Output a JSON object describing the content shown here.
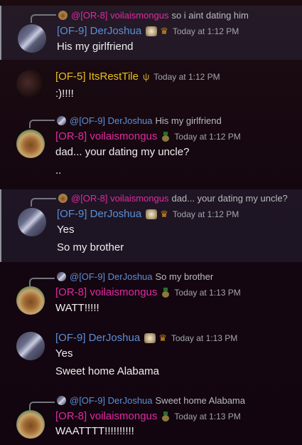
{
  "colors": {
    "der_joshua": "#5b8fd6",
    "voila": "#e02aa0",
    "rest": "#e6c21c"
  },
  "messages": [
    {
      "reply": {
        "name": "@[OR-8] voilaismongus",
        "text": "so i aint dating him"
      },
      "author": "[OF-9] DerJoshua",
      "time": "Today at 1:12 PM",
      "lines": [
        "His my girlfriend"
      ]
    },
    {
      "author": "[OF-5] ItsRestTile",
      "time": "Today at 1:12 PM",
      "lines": [
        ":)!!!!"
      ]
    },
    {
      "reply": {
        "name": "@[OF-9] DerJoshua",
        "text": "His my girlfriend"
      },
      "author": "[OR-8] voilaismongus",
      "time": "Today at 1:12 PM",
      "lines": [
        "dad... your dating my uncle?",
        ".."
      ]
    },
    {
      "reply": {
        "name": "@[OR-8] voilaismongus",
        "text": "dad... your dating my uncle?"
      },
      "author": "[OF-9] DerJoshua",
      "time": "Today at 1:12 PM",
      "lines": [
        "Yes",
        "So my brother"
      ]
    },
    {
      "reply": {
        "name": "@[OF-9] DerJoshua",
        "text": "So my brother"
      },
      "author": "[OR-8] voilaismongus",
      "time": "Today at 1:13 PM",
      "lines": [
        "WATT!!!!!"
      ]
    },
    {
      "author": "[OF-9] DerJoshua",
      "time": "Today at 1:13 PM",
      "lines": [
        "Yes",
        "Sweet home Alabama"
      ]
    },
    {
      "reply": {
        "name": "@[OF-9] DerJoshua",
        "text": "Sweet home Alabama"
      },
      "author": "[OR-8] voilaismongus",
      "time": "Today at 1:13 PM",
      "lines": [
        "WAATTTT!!!!!!!!!!"
      ]
    }
  ]
}
